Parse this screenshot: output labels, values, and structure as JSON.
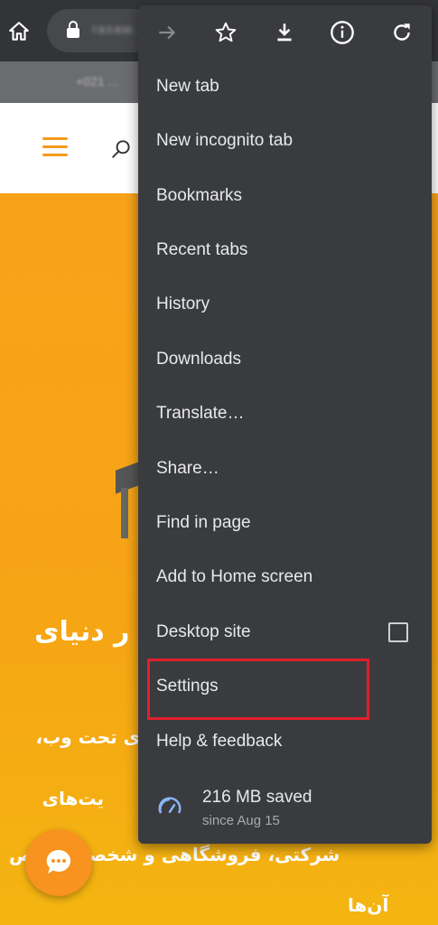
{
  "browser": {
    "url_text": "rasaw...",
    "toolbar_icons": [
      "home-icon",
      "lock-icon",
      "forward-icon",
      "star-icon",
      "download-icon",
      "info-icon",
      "refresh-icon"
    ]
  },
  "page": {
    "phone_text": "+021 ...",
    "hero_title": "ر دنیای",
    "hero_lines": [
      "ی تحت وب،",
      "یت‌های",
      "شرکتی، فروشگاهی و شخصی شخص",
      "آن‌ها"
    ]
  },
  "menu": {
    "items": [
      {
        "label": "New tab"
      },
      {
        "label": "New incognito tab"
      },
      {
        "label": "Bookmarks"
      },
      {
        "label": "Recent tabs"
      },
      {
        "label": "History"
      },
      {
        "label": "Downloads"
      },
      {
        "label": "Translate…"
      },
      {
        "label": "Share…"
      },
      {
        "label": "Find in page"
      },
      {
        "label": "Add to Home screen"
      },
      {
        "label": "Desktop site",
        "checkbox": false
      },
      {
        "label": "Settings",
        "highlighted": true
      },
      {
        "label": "Help & feedback"
      }
    ],
    "data_saver": {
      "main": "216 MB saved",
      "sub": "since Aug 15"
    }
  },
  "colors": {
    "menu_bg": "#3a3b3f",
    "highlight": "#e0202c",
    "page_orange": "#f8a21a"
  }
}
